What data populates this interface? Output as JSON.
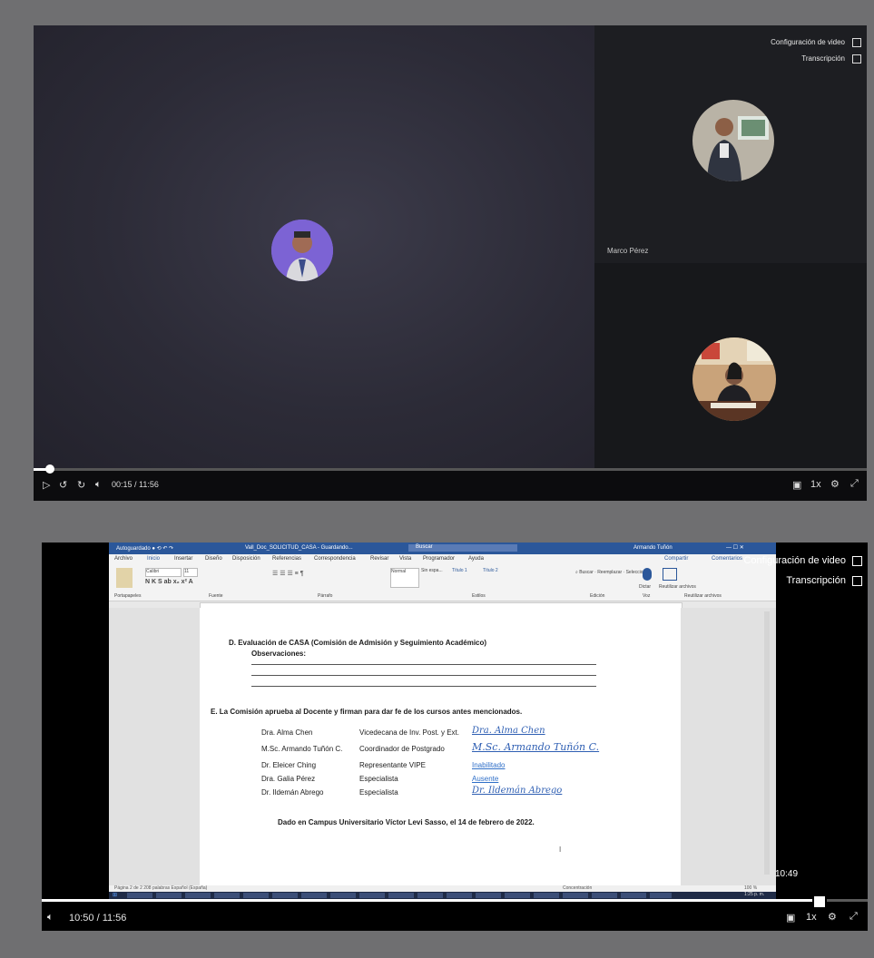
{
  "top_player": {
    "menu": {
      "video_settings": "Configuración de video",
      "transcription": "Transcripción"
    },
    "side_tile_1_name": "Marco Pérez",
    "side_tile_2_name": "",
    "time": "00:15 / 11:56",
    "progress_fraction": 0.02,
    "speed": "1x"
  },
  "bottom_player": {
    "menu": {
      "video_settings": "Configuración de video",
      "transcription": "Transcripción"
    },
    "hover_time": "10:49",
    "time": "10:50 / 11:56",
    "progress_fraction": 0.94,
    "speed": "1x",
    "word": {
      "title": "Vall_Doc_SOLICITUD_CASA - Guardando...",
      "search_placeholder": "Buscar",
      "user": "Armando Tuñón",
      "tabs": [
        "Archivo",
        "Inicio",
        "Insertar",
        "Diseño",
        "Disposición",
        "Referencias",
        "Correspondencia",
        "Revisar",
        "Vista",
        "Programador",
        "Ayuda"
      ],
      "share": "Compartir",
      "comments": "Comentarios",
      "ribbon_groups": [
        "Portapapeles",
        "Fuente",
        "Párrafo",
        "Estilos",
        "Edición",
        "Voz",
        "Reutilizar archivos"
      ],
      "styles": [
        "Normal",
        "Sin espa...",
        "Título 1",
        "Título 2"
      ],
      "font_name": "Calibri",
      "font_size": "11",
      "dictate": "Dictar",
      "reuse": "Reutilizar archivos",
      "status_left": "Página 2 de 2   208 palabras   Español (España)",
      "status_focus": "Concentración",
      "zoom": "100 %",
      "clock": "1:25 p. m."
    },
    "doc": {
      "section_d_title": "D.   Evaluación de CASA (Comisión de Admisión y Seguimiento Académico)",
      "observations": "Observaciones:",
      "section_e_title": "E.   La Comisión aprueba al Docente y firman para dar fe de los cursos antes mencionados.",
      "signatories": [
        {
          "name": "Dra. Alma Chen",
          "role": "Vicedecana de Inv. Post. y Ext.",
          "sign": "Dra. Alma Chen",
          "type": "signature"
        },
        {
          "name": "M.Sc. Armando Tuñón C.",
          "role": "Coordinador de Postgrado",
          "sign": "M.Sc. Armando Tuñón C.",
          "type": "signature"
        },
        {
          "name": "Dr. Eleicer Ching",
          "role": "Representante VIPE",
          "sign": "Inabilitado",
          "type": "link"
        },
        {
          "name": "Dra. Galia Pérez",
          "role": "Especialista",
          "sign": "Ausente",
          "type": "link"
        },
        {
          "name": "Dr. Ildemán Abrego",
          "role": "Especialista",
          "sign": "Dr. Ildemán Abrego",
          "type": "signature"
        }
      ],
      "footer": "Dado en Campus Universitario Víctor Levi Sasso, el 14 de febrero de 2022."
    }
  }
}
